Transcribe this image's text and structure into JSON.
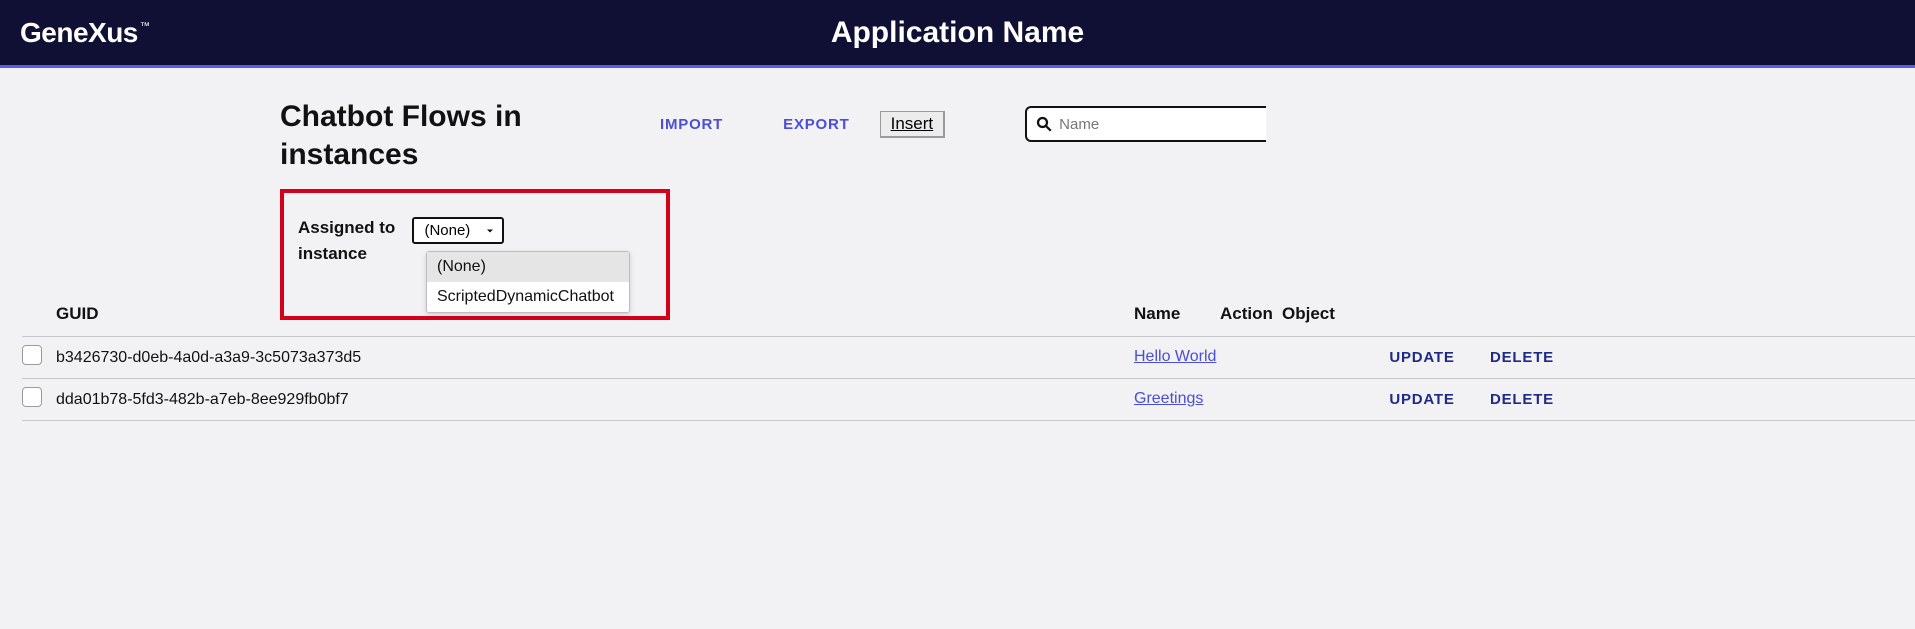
{
  "header": {
    "logo_prefix": "Gene",
    "logo_suffix": "Xus",
    "logo_tm": "™",
    "app_name": "Application Name"
  },
  "page": {
    "title": "Chatbot Flows in instances",
    "actions": {
      "import": "IMPORT",
      "export": "EXPORT",
      "insert": "Insert"
    },
    "search_placeholder": "Name"
  },
  "filter": {
    "label": "Assigned to instance",
    "selected": "(None)",
    "options": [
      "(None)",
      "ScriptedDynamicChatbot"
    ]
  },
  "table": {
    "headers": {
      "guid": "GUID",
      "name": "Name",
      "action": "Action",
      "object": "Object"
    },
    "row_actions": {
      "update": "UPDATE",
      "delete": "DELETE"
    },
    "rows": [
      {
        "guid": "b3426730-d0eb-4a0d-a3a9-3c5073a373d5",
        "name": "Hello World"
      },
      {
        "guid": "dda01b78-5fd3-482b-a7eb-8ee929fb0bf7",
        "name": "Greetings"
      }
    ]
  }
}
